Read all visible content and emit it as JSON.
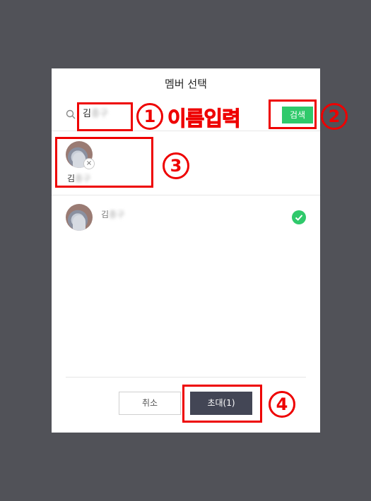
{
  "dialog": {
    "title": "멤버 선택",
    "search": {
      "value_prefix": "김",
      "value_blurred": "종구",
      "button_label": "검색"
    },
    "selected_chip": {
      "name_prefix": "김",
      "name_blurred": "종구",
      "remove_glyph": "×"
    },
    "members": [
      {
        "name_prefix": "김",
        "name_blurred": "종구",
        "checked": true
      }
    ],
    "footer": {
      "cancel_label": "취소",
      "invite_label": "초대(1)"
    }
  },
  "annotations": {
    "step1": "1",
    "step1_text": "이름입력",
    "step2": "2",
    "step3": "3",
    "step4": "4",
    "color": "#ee0000"
  },
  "colors": {
    "overlay_bg": "#515258",
    "search_button": "#2fc96b",
    "invite_button": "#434655",
    "check": "#2fc96b"
  },
  "icons": {
    "search": "search-icon",
    "check": "check-circle-icon",
    "remove": "close-icon"
  }
}
